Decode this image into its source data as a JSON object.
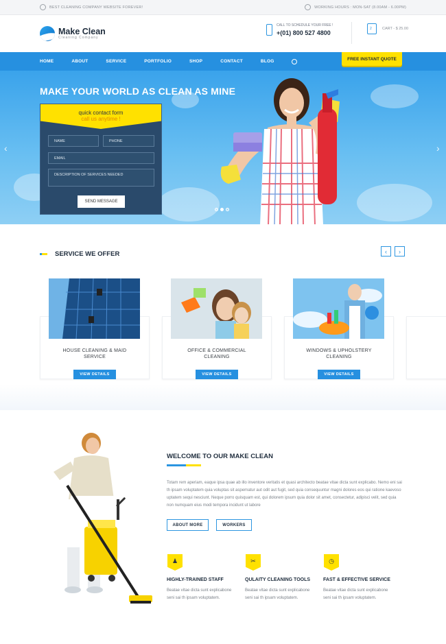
{
  "topbar": {
    "left_text": "BEST CLEANING COMPANY WEBSITE FOREVER!",
    "right_text": "WORKING HOURS : MON-SAT (8.00AM - 6.00PM)"
  },
  "header": {
    "logo_title": "Make Clean",
    "logo_subtitle": "Cleaning Company",
    "call_label": "CALL TO SCHEDULE YOUR FREE !",
    "phone": "+(01) 800 527 4800",
    "cart_count": "2",
    "cart_text": "CART - $ 25.00"
  },
  "nav": {
    "items": [
      "HOME",
      "ABOUT",
      "SERVICE",
      "PORTFOLIO",
      "SHOP",
      "CONTACT",
      "BLOG"
    ],
    "quote": "FREE INSTANT QUOTE"
  },
  "hero": {
    "title": "MAKE YOUR WORLD AS CLEAN AS MINE",
    "form_title": "quick contact form",
    "form_subtitle": "call us anytime !",
    "name_ph": "NAME",
    "phone_ph": "PHONE",
    "email_ph": "EMAIL",
    "desc_ph": "DESCRIPTION OF SERVICES NEEDED",
    "send": "SEND MESSAGE",
    "prev_arrow": "‹",
    "next_arrow": "›"
  },
  "services": {
    "title": "SERVICE WE OFFER",
    "prev": "‹",
    "next": "›",
    "cards": [
      {
        "title_l1": "HOUSE CLEANING & MAID",
        "title_l2": "SERVICE",
        "button": "VIEW DETAILS"
      },
      {
        "title_l1": "OFFICE & COMMERCIAL",
        "title_l2": "CLEANING",
        "button": "VIEW DETAILS"
      },
      {
        "title_l1": "WINDOWS & UPHOLSTERY",
        "title_l2": "CLEANING",
        "button": "VIEW DETAILS"
      }
    ]
  },
  "welcome": {
    "title": "WELCOME TO OUR MAKE CLEAN",
    "paragraph": "Totam rem aperiam, eaque ipsa quae ab illo inventore veritatis et quasi architecto beatae vitae dicta sunt explicabo. Nemo eni sai th ipsam voluptatem quia voluptas sit aspernatur aut odit aut fugit, sed quia consequuntur magni dolores eos qui ratione kaevoso uptatem sequi nesciunt. Neque porro quisquam est, qui dolorem ipsum quia dolor sit amet, consectetur, adipisci velit, sed quia non numquam eius modi tempora incidunt ut labore",
    "about_btn": "ABOUT MORE",
    "workers_btn": "WORKERS",
    "features": [
      {
        "title": "HIGHLY-TRAINED STAFF",
        "desc": "Beatae vitae dicta sunt explicabone seni sai th ipsam voluptatem."
      },
      {
        "title": "QULAITY CLEANING TOOLS",
        "desc": "Beatae vitae dicta sunt explicabone seni sai th ipsam voluptatem."
      },
      {
        "title": "FAST & EFFECTIVE SERVICE",
        "desc": "Beatae vitae dicta sunt explicabone seni sai th ipsam voluptatem."
      }
    ]
  }
}
